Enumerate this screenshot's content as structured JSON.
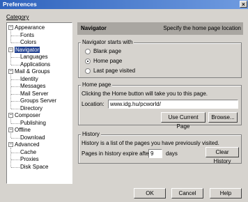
{
  "window": {
    "title": "Preferences",
    "close_glyph": "×"
  },
  "category_label": "Category",
  "tree": [
    {
      "label": "Appearance",
      "level": 0,
      "expander": "−"
    },
    {
      "label": "Fonts",
      "level": 1
    },
    {
      "label": "Colors",
      "level": 1
    },
    {
      "label": "Navigator",
      "level": 0,
      "expander": "−",
      "selected": true
    },
    {
      "label": "Languages",
      "level": 1
    },
    {
      "label": "Applications",
      "level": 1
    },
    {
      "label": "Mail & Groups",
      "level": 0,
      "expander": "−"
    },
    {
      "label": "Identity",
      "level": 1
    },
    {
      "label": "Messages",
      "level": 1
    },
    {
      "label": "Mail Server",
      "level": 1
    },
    {
      "label": "Groups Server",
      "level": 1
    },
    {
      "label": "Directory",
      "level": 1
    },
    {
      "label": "Composer",
      "level": 0,
      "expander": "−"
    },
    {
      "label": "Publishing",
      "level": 1
    },
    {
      "label": "Offline",
      "level": 0,
      "expander": "−"
    },
    {
      "label": "Download",
      "level": 1
    },
    {
      "label": "Advanced",
      "level": 0,
      "expander": "−"
    },
    {
      "label": "Cache",
      "level": 1
    },
    {
      "label": "Proxies",
      "level": 1
    },
    {
      "label": "Disk Space",
      "level": 1
    }
  ],
  "header": {
    "title": "Navigator",
    "subtitle": "Specify the home page location"
  },
  "starts_with": {
    "legend": "Navigator starts with",
    "options": [
      {
        "label": "Blank page",
        "selected": false
      },
      {
        "label": "Home page",
        "selected": true
      },
      {
        "label": "Last page visited",
        "selected": false
      }
    ]
  },
  "home_page": {
    "legend": "Home page",
    "description": "Clicking the Home button will take you to this page.",
    "location_label": "Location:",
    "location_value": "www.idg.hu/pcworld/",
    "use_current_label": "Use Current Page",
    "browse_label": "Browse..."
  },
  "history": {
    "legend": "History",
    "description": "History is a list of the pages you have previously visited.",
    "expire_label": "Pages in history expire after:",
    "expire_value": "9",
    "days_label": "days",
    "clear_label": "Clear History"
  },
  "footer": {
    "ok_label": "OK",
    "cancel_label": "Cancel",
    "help_label": "Help"
  }
}
